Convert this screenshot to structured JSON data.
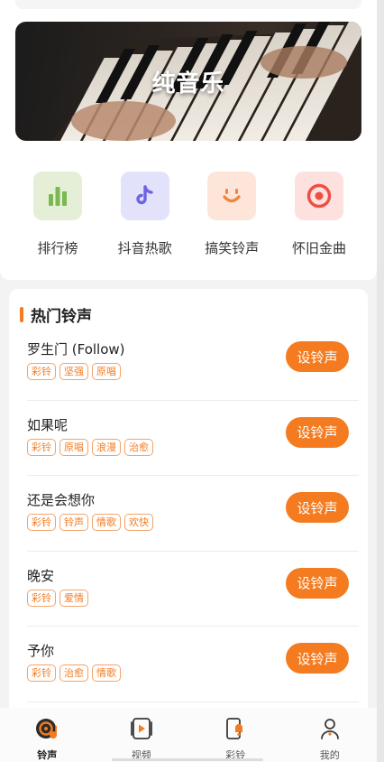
{
  "banner": {
    "title": "纯音乐"
  },
  "quick_links": [
    {
      "label": "排行榜",
      "icon": "chart-bars-icon",
      "bg": "#e5efd7",
      "fg": "#7bb84f"
    },
    {
      "label": "抖音热歌",
      "icon": "tiktok-icon",
      "bg": "#e3e2fb",
      "fg": "#6c63e6"
    },
    {
      "label": "搞笑铃声",
      "icon": "smile-icon",
      "bg": "#fde6d9",
      "fg": "#f5813a"
    },
    {
      "label": "怀旧金曲",
      "icon": "record-target-icon",
      "bg": "#fde1df",
      "fg": "#ef4e43"
    }
  ],
  "hot": {
    "title": "热门铃声",
    "button_label": "设铃声",
    "songs": [
      {
        "name": "罗生门 (Follow)",
        "tags": [
          "彩铃",
          "坚强",
          "原唱"
        ]
      },
      {
        "name": "如果呢",
        "tags": [
          "彩铃",
          "原唱",
          "浪漫",
          "治愈"
        ]
      },
      {
        "name": "还是会想你",
        "tags": [
          "彩铃",
          "铃声",
          "情歌",
          "欢快"
        ]
      },
      {
        "name": "晚安",
        "tags": [
          "彩铃",
          "爱情"
        ]
      },
      {
        "name": "予你",
        "tags": [
          "彩铃",
          "治愈",
          "情歌"
        ]
      }
    ]
  },
  "tabs": [
    {
      "label": "铃声",
      "icon": "ringtone-disc-icon",
      "active": true
    },
    {
      "label": "视频",
      "icon": "video-play-icon",
      "active": false
    },
    {
      "label": "彩铃",
      "icon": "phone-bell-icon",
      "active": false
    },
    {
      "label": "我的",
      "icon": "user-icon",
      "active": false
    }
  ],
  "colors": {
    "accent": "#f47b20",
    "tag_border": "#f3a36a"
  }
}
